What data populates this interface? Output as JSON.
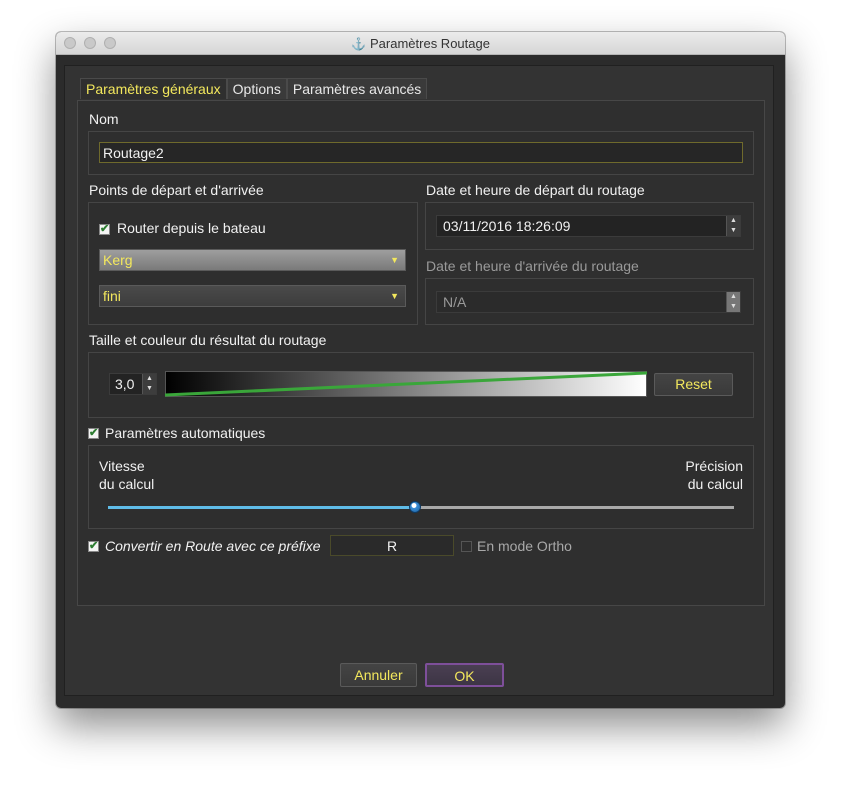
{
  "window": {
    "title": "Paramètres Routage"
  },
  "tabs": [
    {
      "label": "Paramètres généraux",
      "active": true
    },
    {
      "label": "Options",
      "active": false
    },
    {
      "label": "Paramètres avancés",
      "active": false
    }
  ],
  "name_section": {
    "label": "Nom",
    "value": "Routage2"
  },
  "points": {
    "label": "Points de départ et d'arrivée",
    "route_from_boat": {
      "label": "Router depuis le bateau",
      "checked": true
    },
    "start_combo": "Kerg",
    "end_combo": "fini"
  },
  "departure": {
    "label": "Date et heure de départ du routage",
    "value": "03/11/2016 18:26:09"
  },
  "arrival": {
    "label": "Date et heure d'arrivée du routage",
    "value": "N/A"
  },
  "result_style": {
    "label": "Taille et couleur du résultat du routage",
    "size_value": "3,0",
    "reset_label": "Reset",
    "line_color": "#3aa63a"
  },
  "auto_params": {
    "label": "Paramètres automatiques",
    "checked": true
  },
  "speed_slider": {
    "left_label_1": "Vitesse",
    "left_label_2": "du calcul",
    "right_label_1": "Précision",
    "right_label_2": "du calcul",
    "value": 0.49
  },
  "convert": {
    "label": "Convertir en Route avec ce préfixe",
    "checked": true,
    "prefix_value": "R",
    "ortho_label": "En mode Ortho",
    "ortho_checked": false
  },
  "buttons": {
    "cancel": "Annuler",
    "ok": "OK"
  },
  "colors": {
    "accent": "#f3e85d",
    "background": "#2f2f2f",
    "ok_border": "#7e4f9a"
  }
}
